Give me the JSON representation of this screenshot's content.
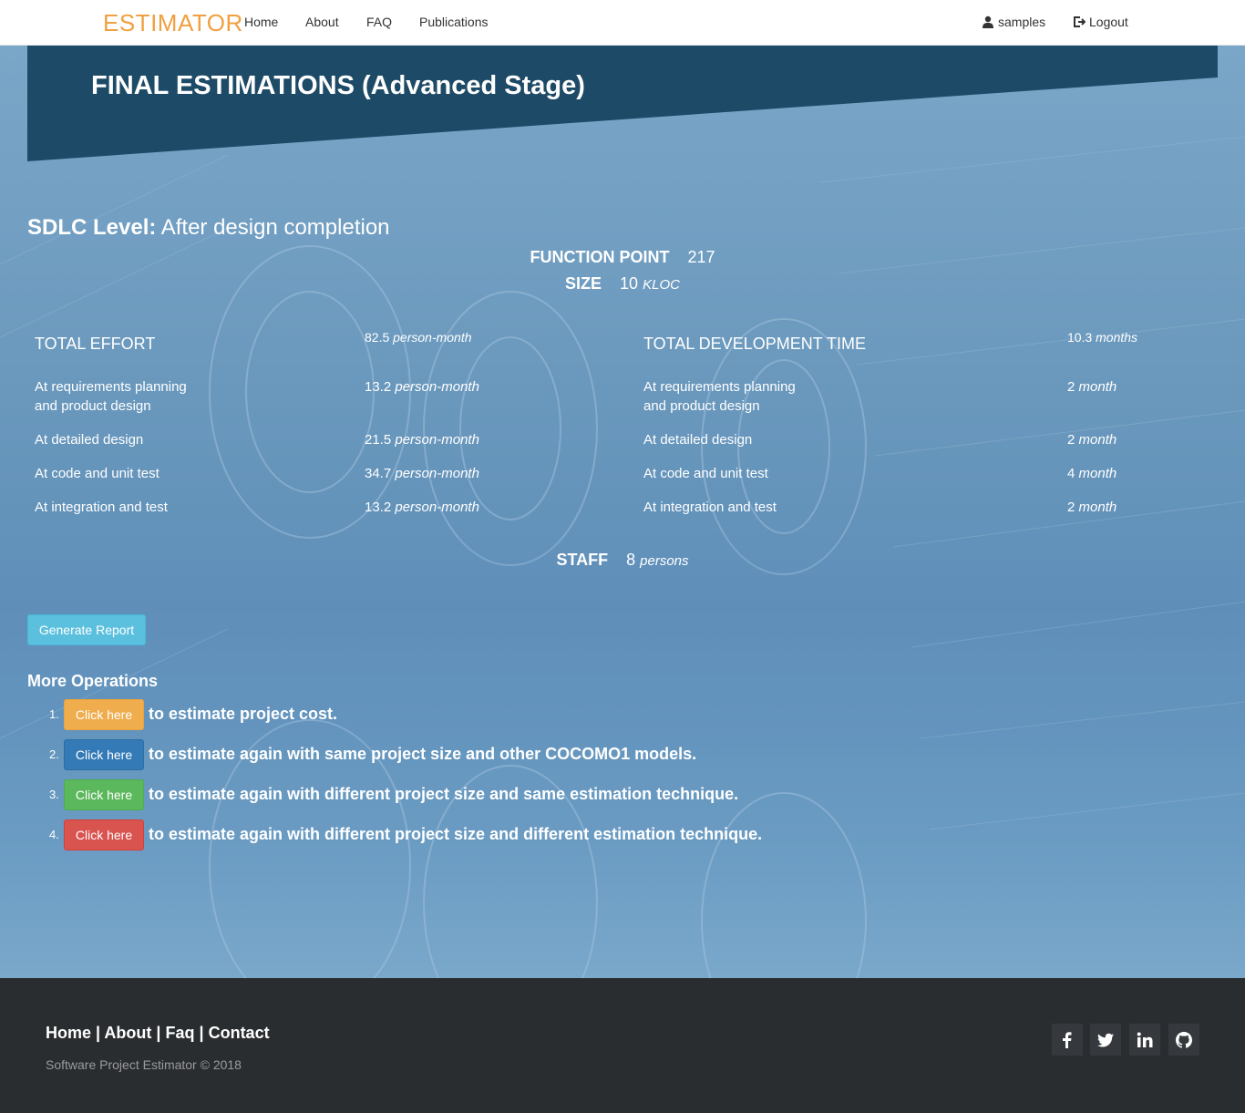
{
  "navbar": {
    "brand": "ESTIMATOR",
    "links": [
      "Home",
      "About",
      "FAQ",
      "Publications"
    ],
    "user": "samples",
    "logout": "Logout"
  },
  "banner": {
    "title": "FINAL ESTIMATIONS (Advanced Stage)"
  },
  "sdlc": {
    "label": "SDLC Level:",
    "value": "After design completion"
  },
  "function_point": {
    "label": "FUNCTION POINT",
    "value": "217"
  },
  "size": {
    "label": "SIZE",
    "value": "10",
    "unit": "KLOC"
  },
  "effort": {
    "title": "TOTAL EFFORT",
    "total_value": "82.5",
    "unit": "person-month",
    "rows": [
      {
        "label_line1": "At requirements planning",
        "label_line2": "and product design",
        "value": "13.2"
      },
      {
        "label_line1": "At detailed design",
        "label_line2": "",
        "value": "21.5"
      },
      {
        "label_line1": "At code and unit test",
        "label_line2": "",
        "value": "34.7"
      },
      {
        "label_line1": "At integration and test",
        "label_line2": "",
        "value": "13.2"
      }
    ]
  },
  "time": {
    "title": "TOTAL DEVELOPMENT TIME",
    "total_value": "10.3",
    "total_unit": "months",
    "unit": "month",
    "rows": [
      {
        "label_line1": "At requirements planning",
        "label_line2": "and product design",
        "value": "2"
      },
      {
        "label_line1": "At detailed design",
        "label_line2": "",
        "value": "2"
      },
      {
        "label_line1": "At code and unit test",
        "label_line2": "",
        "value": "4"
      },
      {
        "label_line1": "At integration and test",
        "label_line2": "",
        "value": "2"
      }
    ]
  },
  "staff": {
    "label": "STAFF",
    "value": "8",
    "unit": "persons"
  },
  "generate_report": "Generate Report",
  "more_operations": {
    "title": "More Operations",
    "items": [
      {
        "num": "1.",
        "button": "Click here",
        "text": "to estimate project cost.",
        "color": "#f0ad4e"
      },
      {
        "num": "2.",
        "button": "Click here",
        "text": "to estimate again with same project size and other COCOMO1 models.",
        "color": "#337ab7"
      },
      {
        "num": "3.",
        "button": "Click here",
        "text": "to estimate again with different project size and same estimation technique.",
        "color": "#5cb85c"
      },
      {
        "num": "4.",
        "button": "Click here",
        "text": "to estimate again with different project size and different estimation technique.",
        "color": "#d9534f"
      }
    ]
  },
  "footer": {
    "links": [
      "Home",
      "About",
      "Faq",
      "Contact"
    ],
    "separator": "|",
    "copyright": "Software Project Estimator © 2018",
    "social": [
      "facebook-icon",
      "twitter-icon",
      "linkedin-icon",
      "github-icon"
    ]
  }
}
